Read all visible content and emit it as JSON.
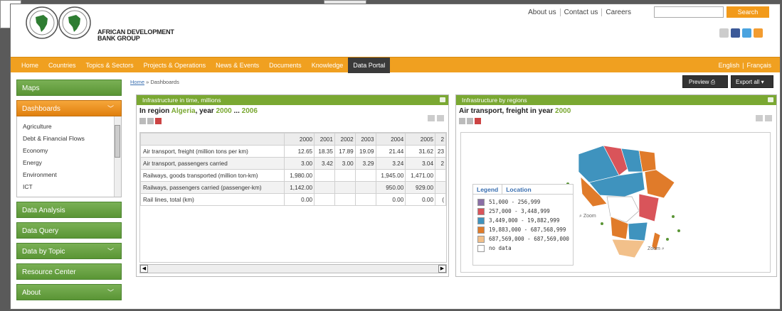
{
  "header": {
    "org_line1": "AFRICAN DEVELOPMENT",
    "org_line2": "BANK GROUP",
    "top_links": [
      "About us",
      "Contact us",
      "Careers"
    ],
    "search_placeholder": "",
    "search_button": "Search"
  },
  "nav": {
    "items": [
      "Home",
      "Countries",
      "Topics & Sectors",
      "Projects & Operations",
      "News & Events",
      "Documents",
      "Knowledge",
      "Data Portal"
    ],
    "active": "Data Portal",
    "lang_en": "English",
    "lang_sep": "|",
    "lang_fr": "Français"
  },
  "sidebar": {
    "maps": "Maps",
    "dashboards": "Dashboards",
    "sub_items": [
      "Agriculture",
      "Debt & Financial Flows",
      "Economy",
      "Energy",
      "Environment",
      "ICT"
    ],
    "data_analysis": "Data Analysis",
    "data_query": "Data Query",
    "data_by_topic": "Data by Topic",
    "resource_center": "Resource Center",
    "about": "About"
  },
  "breadcrumb": {
    "home": "Home",
    "sep": "»",
    "current": "Dashboards"
  },
  "toolbar": {
    "preview": "Preview",
    "export": "Export all"
  },
  "left_panel": {
    "title": "Infrastructure in time, millions",
    "sub_prefix": "In region",
    "region": "Algeria",
    "sub_year": ", year",
    "year_from": "2000",
    "ellipsis": "...",
    "year_to": "2006",
    "table": {
      "columns": [
        "",
        "2000",
        "2001",
        "2002",
        "2003",
        "2004",
        "2005",
        "2"
      ],
      "rows": [
        [
          "Air transport, freight (million tons per km)",
          "12.65",
          "18.35",
          "17.89",
          "19.09",
          "21.44",
          "31.62",
          "23"
        ],
        [
          "Air transport, passengers carried",
          "3.00",
          "3.42",
          "3.00",
          "3.29",
          "3.24",
          "3.04",
          "2"
        ],
        [
          "Railways, goods transported (million ton-km)",
          "1,980.00",
          "",
          "",
          "",
          "1,945.00",
          "1,471.00",
          ""
        ],
        [
          "Railways, passengers carried (passenger-km)",
          "1,142.00",
          "",
          "",
          "",
          "950.00",
          "929.00",
          ""
        ],
        [
          "Rail lines, total (km)",
          "0.00",
          "",
          "",
          "",
          "0.00",
          "0.00",
          "("
        ]
      ]
    }
  },
  "right_panel": {
    "title": "Infrastructure by regions",
    "sub_prefix": "Air transport, freight in year",
    "year": "2000",
    "legend_tab": "Legend",
    "location_tab": "Location",
    "legend": [
      {
        "label": "51,000 - 256,999",
        "color": "#8a6fa6"
      },
      {
        "label": "257,000 - 3,448,999",
        "color": "#d9545a"
      },
      {
        "label": "3,449,000 - 19,882,999",
        "color": "#3f93be"
      },
      {
        "label": "19,883,000 - 687,568,999",
        "color": "#e07b2a"
      },
      {
        "label": "687,569,000 - 687,569,000",
        "color": "#f2c08a"
      },
      {
        "label": "no data",
        "color": "#ffffff"
      }
    ],
    "zoom1": "Zoom",
    "zoom2": "Zoom"
  },
  "colors": {
    "nav_orange": "#f0a020",
    "panel_green": "#7aa832",
    "sidebar_green": "#5a9535",
    "active_orange": "#e8900e"
  }
}
